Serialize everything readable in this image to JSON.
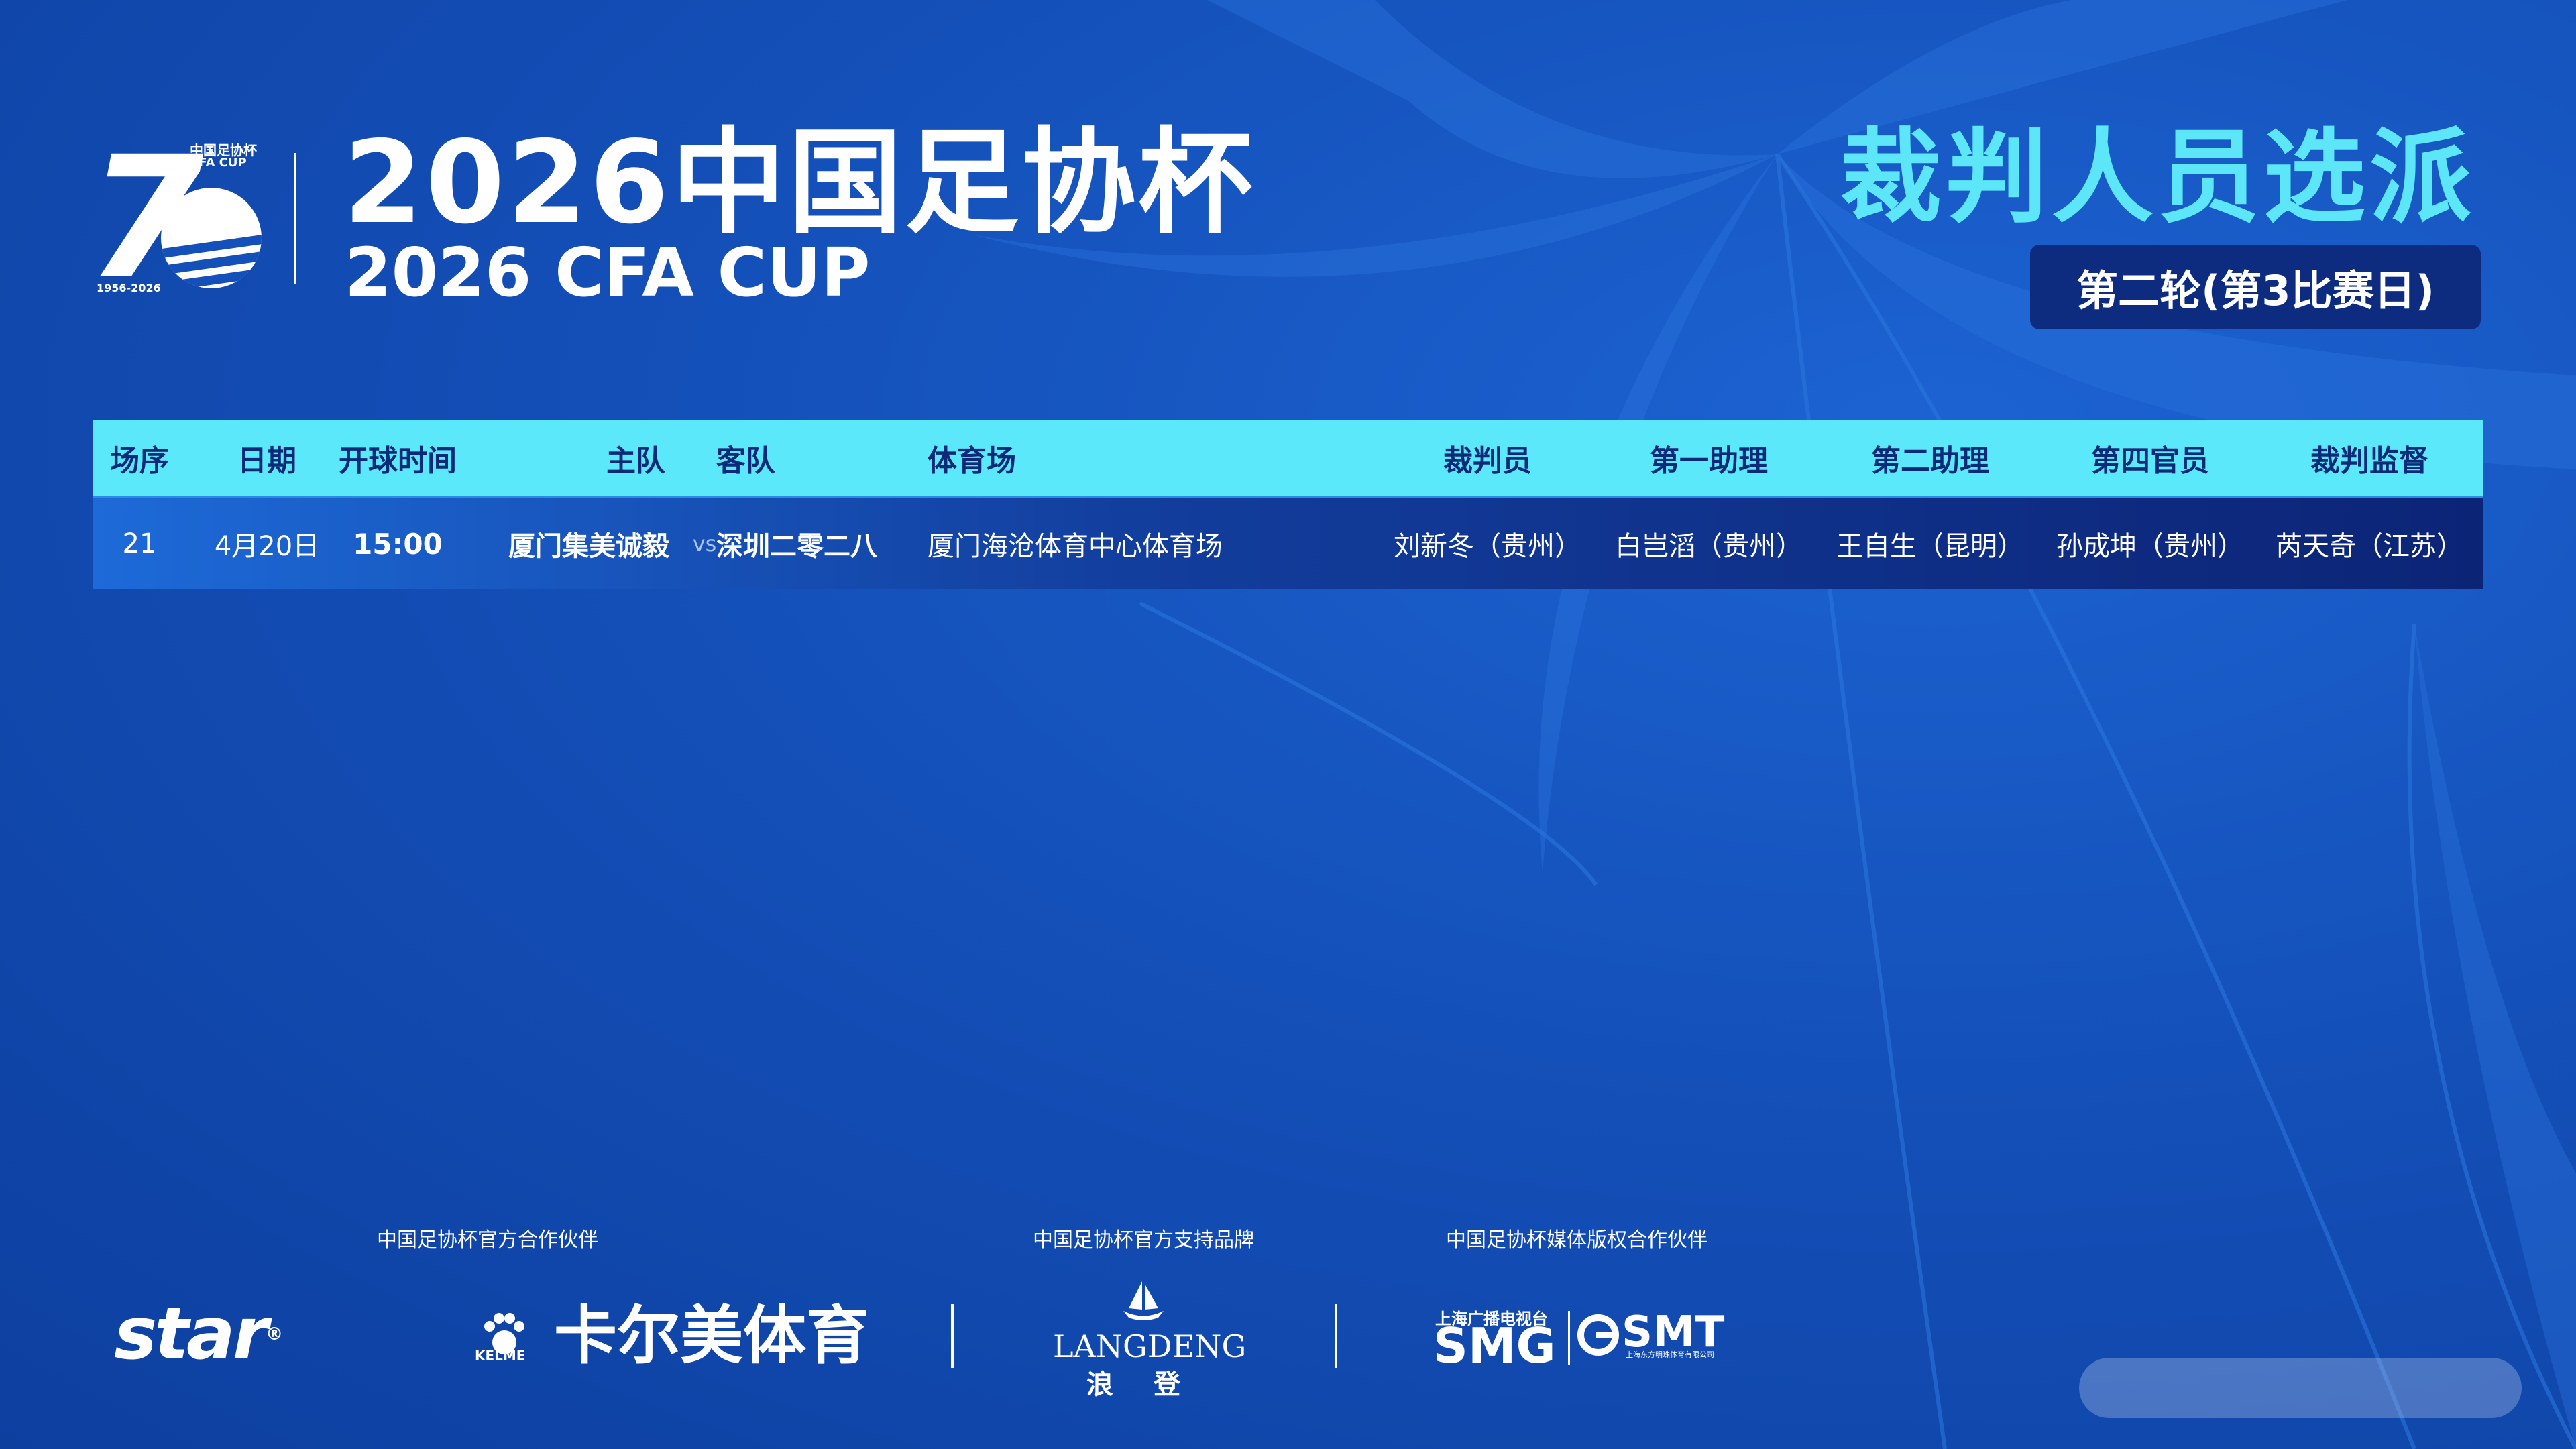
{
  "logo": {
    "seven": "7",
    "small_cn": "中国足协杯",
    "small_en": "CFA CUP",
    "years": "1956-2026"
  },
  "title": {
    "cn": "2026中国足协杯",
    "en": "2026 CFA CUP"
  },
  "heading": "裁判人员选派",
  "round": "第二轮(第3比赛日)",
  "table": {
    "headers": {
      "seq": "场序",
      "date": "日期",
      "time": "开球时间",
      "home": "主队",
      "away": "客队",
      "stadium": "体育场",
      "referee": "裁判员",
      "assistant1": "第一助理",
      "assistant2": "第二助理",
      "fourth": "第四官员",
      "supervisor": "裁判监督"
    },
    "rows": [
      {
        "seq": "21",
        "date": "4月20日",
        "time": "15:00",
        "home": "厦门集美诚毅",
        "vs": "vs",
        "away": "深圳二零二八",
        "stadium": "厦门海沧体育中心体育场",
        "referee": "刘新冬（贵州）",
        "assistant1": "白岂滔（贵州）",
        "assistant2": "王自生（昆明）",
        "fourth": "孙成坤（贵州）",
        "supervisor": "芮天奇（江苏）"
      }
    ]
  },
  "sponsors": {
    "partner_label": "中国足协杯官方合作伙伴",
    "brand_label": "中国足协杯官方支持品牌",
    "media_label": "中国足协杯媒体版权合作伙伴",
    "star": "star",
    "star_reg": "®",
    "kelme_sub": "KELME",
    "kelme_text": "卡尔美体育",
    "langdeng_en": "LANGDENG",
    "langdeng_cn": "浪登",
    "smg_small": "上海广播电视台",
    "smg": "SMG",
    "smt": "SMT",
    "smt_sub": "上海东方明珠体育有限公司"
  },
  "colors": {
    "background": "#1450b9",
    "accent_cyan": "#5ce6f8",
    "header_text": "#0d2a78",
    "badge": "#0d2c80"
  }
}
